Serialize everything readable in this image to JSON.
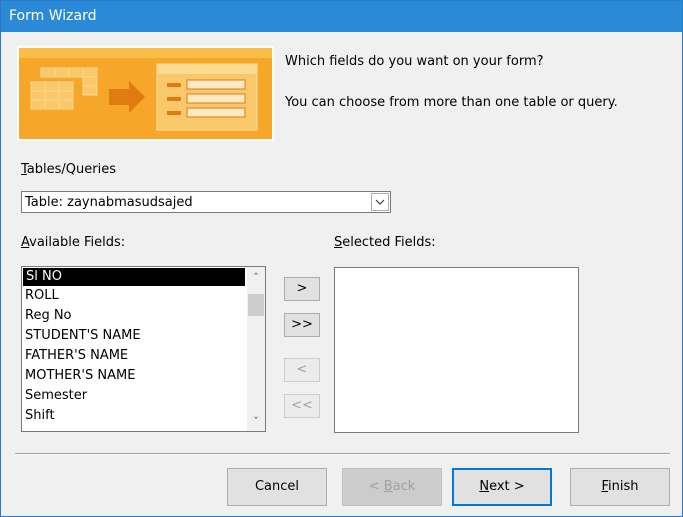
{
  "window": {
    "title": "Form Wizard"
  },
  "prompt": {
    "line1": "Which fields do you want on your form?",
    "line2": "You can choose from more than one table or query."
  },
  "tables_queries": {
    "label_mnemonic": "T",
    "label_rest": "ables/Queries",
    "selected": "Table: zaynabmasudsajed"
  },
  "available_fields": {
    "label_mnemonic": "A",
    "label_rest": "vailable Fields:",
    "items": [
      "Sl NO",
      "ROLL",
      "Reg No",
      "STUDENT'S NAME",
      "FATHER'S NAME",
      "MOTHER'S NAME",
      "Semester",
      "Shift"
    ]
  },
  "selected_fields": {
    "label_mnemonic": "S",
    "label_rest": "elected Fields:"
  },
  "move_buttons": {
    "add_one": ">",
    "add_all": ">>",
    "remove_one": "<",
    "remove_all": "<<"
  },
  "footer": {
    "cancel": "Cancel",
    "back_mnemonic": "B",
    "back_pre": "< ",
    "back_rest": "ack",
    "next_mnemonic": "N",
    "next_rest": "ext >",
    "finish_mnemonic": "F",
    "finish_rest": "inish"
  },
  "colors": {
    "titlebar": "#2a8ad8",
    "default_button_border": "#0078d7",
    "banner": "#f5a623"
  }
}
